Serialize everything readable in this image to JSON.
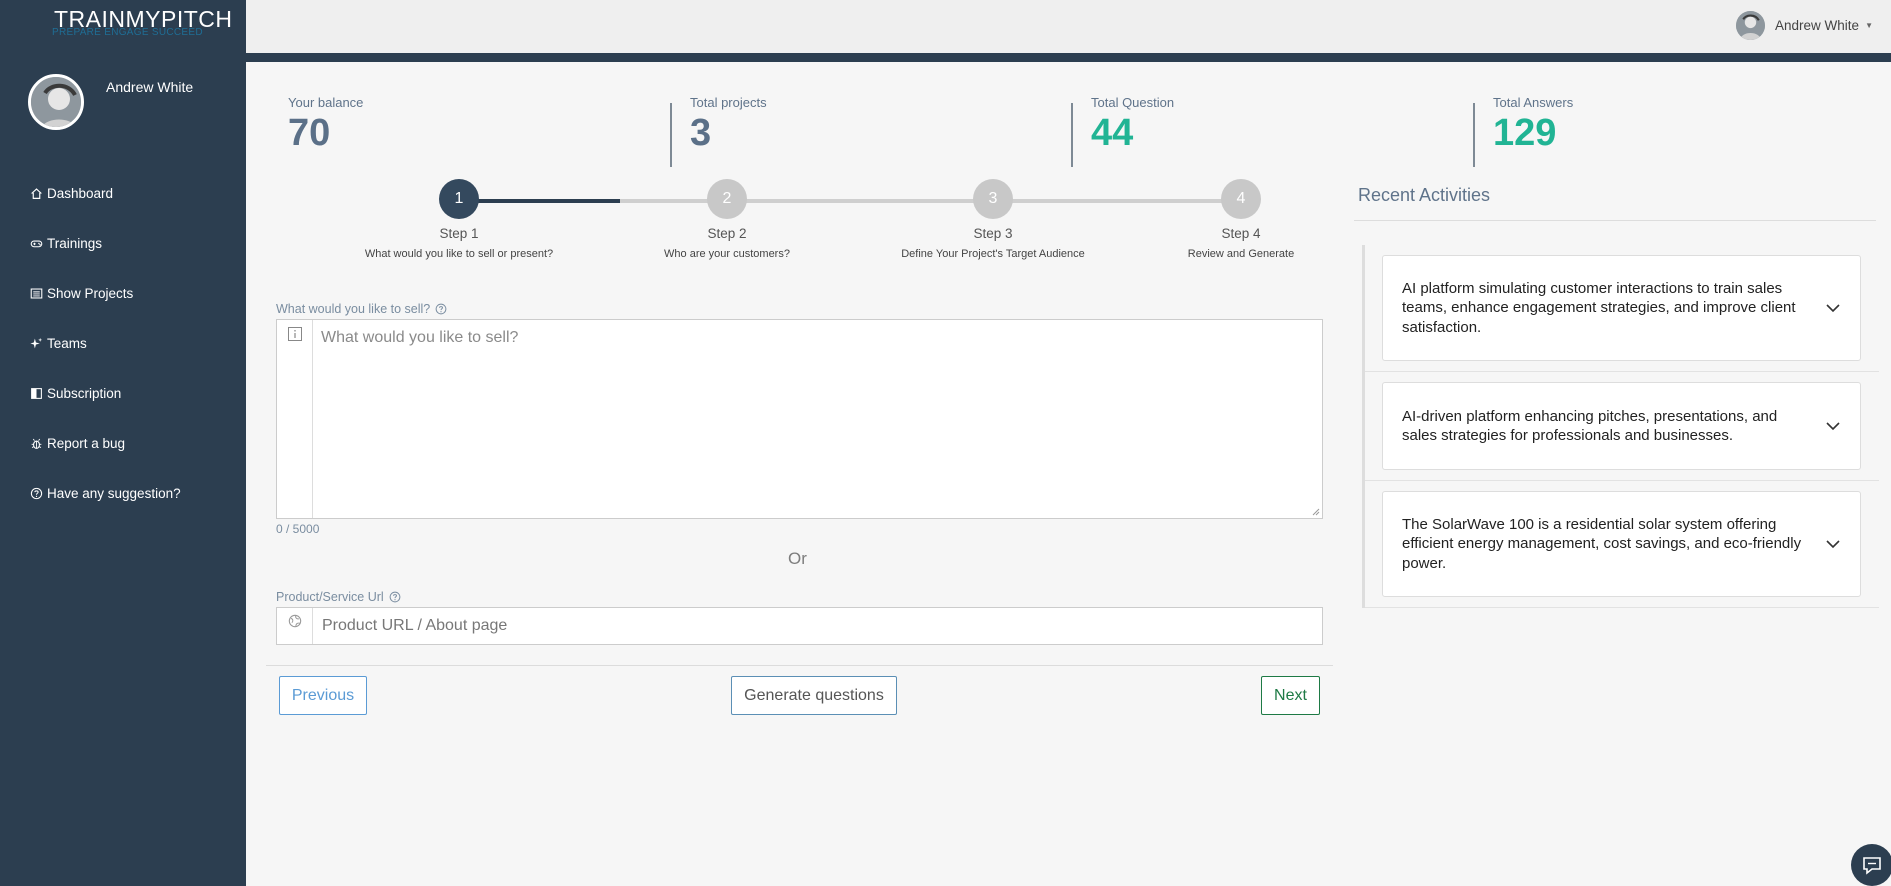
{
  "brand": {
    "name": "TRAINMYPITCH",
    "tagline": "PREPARE ENGAGE SUCCEED"
  },
  "user": {
    "name": "Andrew White"
  },
  "nav": [
    {
      "label": "Dashboard",
      "icon": "home-icon"
    },
    {
      "label": "Trainings",
      "icon": "gamepad-icon"
    },
    {
      "label": "Show Projects",
      "icon": "list-icon"
    },
    {
      "label": "Teams",
      "icon": "sparkle-icon"
    },
    {
      "label": "Subscription",
      "icon": "half-square-icon"
    },
    {
      "label": "Report a bug",
      "icon": "bug-icon"
    },
    {
      "label": "Have any suggestion?",
      "icon": "question-circle-icon"
    }
  ],
  "stats": {
    "balance": {
      "label": "Your balance",
      "value": "70"
    },
    "projects": {
      "label": "Total projects",
      "value": "3"
    },
    "questions": {
      "label": "Total Question",
      "value": "44"
    },
    "answers": {
      "label": "Total Answers",
      "value": "129"
    }
  },
  "steps": [
    {
      "number": "1",
      "title": "Step 1",
      "subtitle": "What would you like to sell or present?"
    },
    {
      "number": "2",
      "title": "Step 2",
      "subtitle": "Who are your customers?"
    },
    {
      "number": "3",
      "title": "Step 3",
      "subtitle": "Define Your Project's Target Audience"
    },
    {
      "number": "4",
      "title": "Step 4",
      "subtitle": "Review and Generate"
    }
  ],
  "form": {
    "sell_label": "What would you like to sell?",
    "sell_placeholder": "What would you like to sell?",
    "sell_value": "",
    "char_count": "0 / 5000",
    "or_text": "Or",
    "url_label": "Product/Service Url",
    "url_placeholder": "Product URL / About page",
    "url_value": ""
  },
  "buttons": {
    "previous": "Previous",
    "generate": "Generate questions",
    "next": "Next"
  },
  "recent": {
    "title": "Recent Activities",
    "items": [
      "AI platform simulating customer interactions to train sales teams, enhance engagement strategies, and improve client satisfaction.",
      "AI-driven platform enhancing pitches, presentations, and sales strategies for professionals and businesses.",
      "The SolarWave 100 is a residential solar system offering efficient energy management, cost savings, and eco-friendly power."
    ]
  },
  "colors": {
    "sidebar": "#2c3e50",
    "accent_teal": "#21b494",
    "stat_slate": "#5b7088",
    "next_green": "#1e7a45",
    "prev_blue": "#5b9bd5"
  }
}
